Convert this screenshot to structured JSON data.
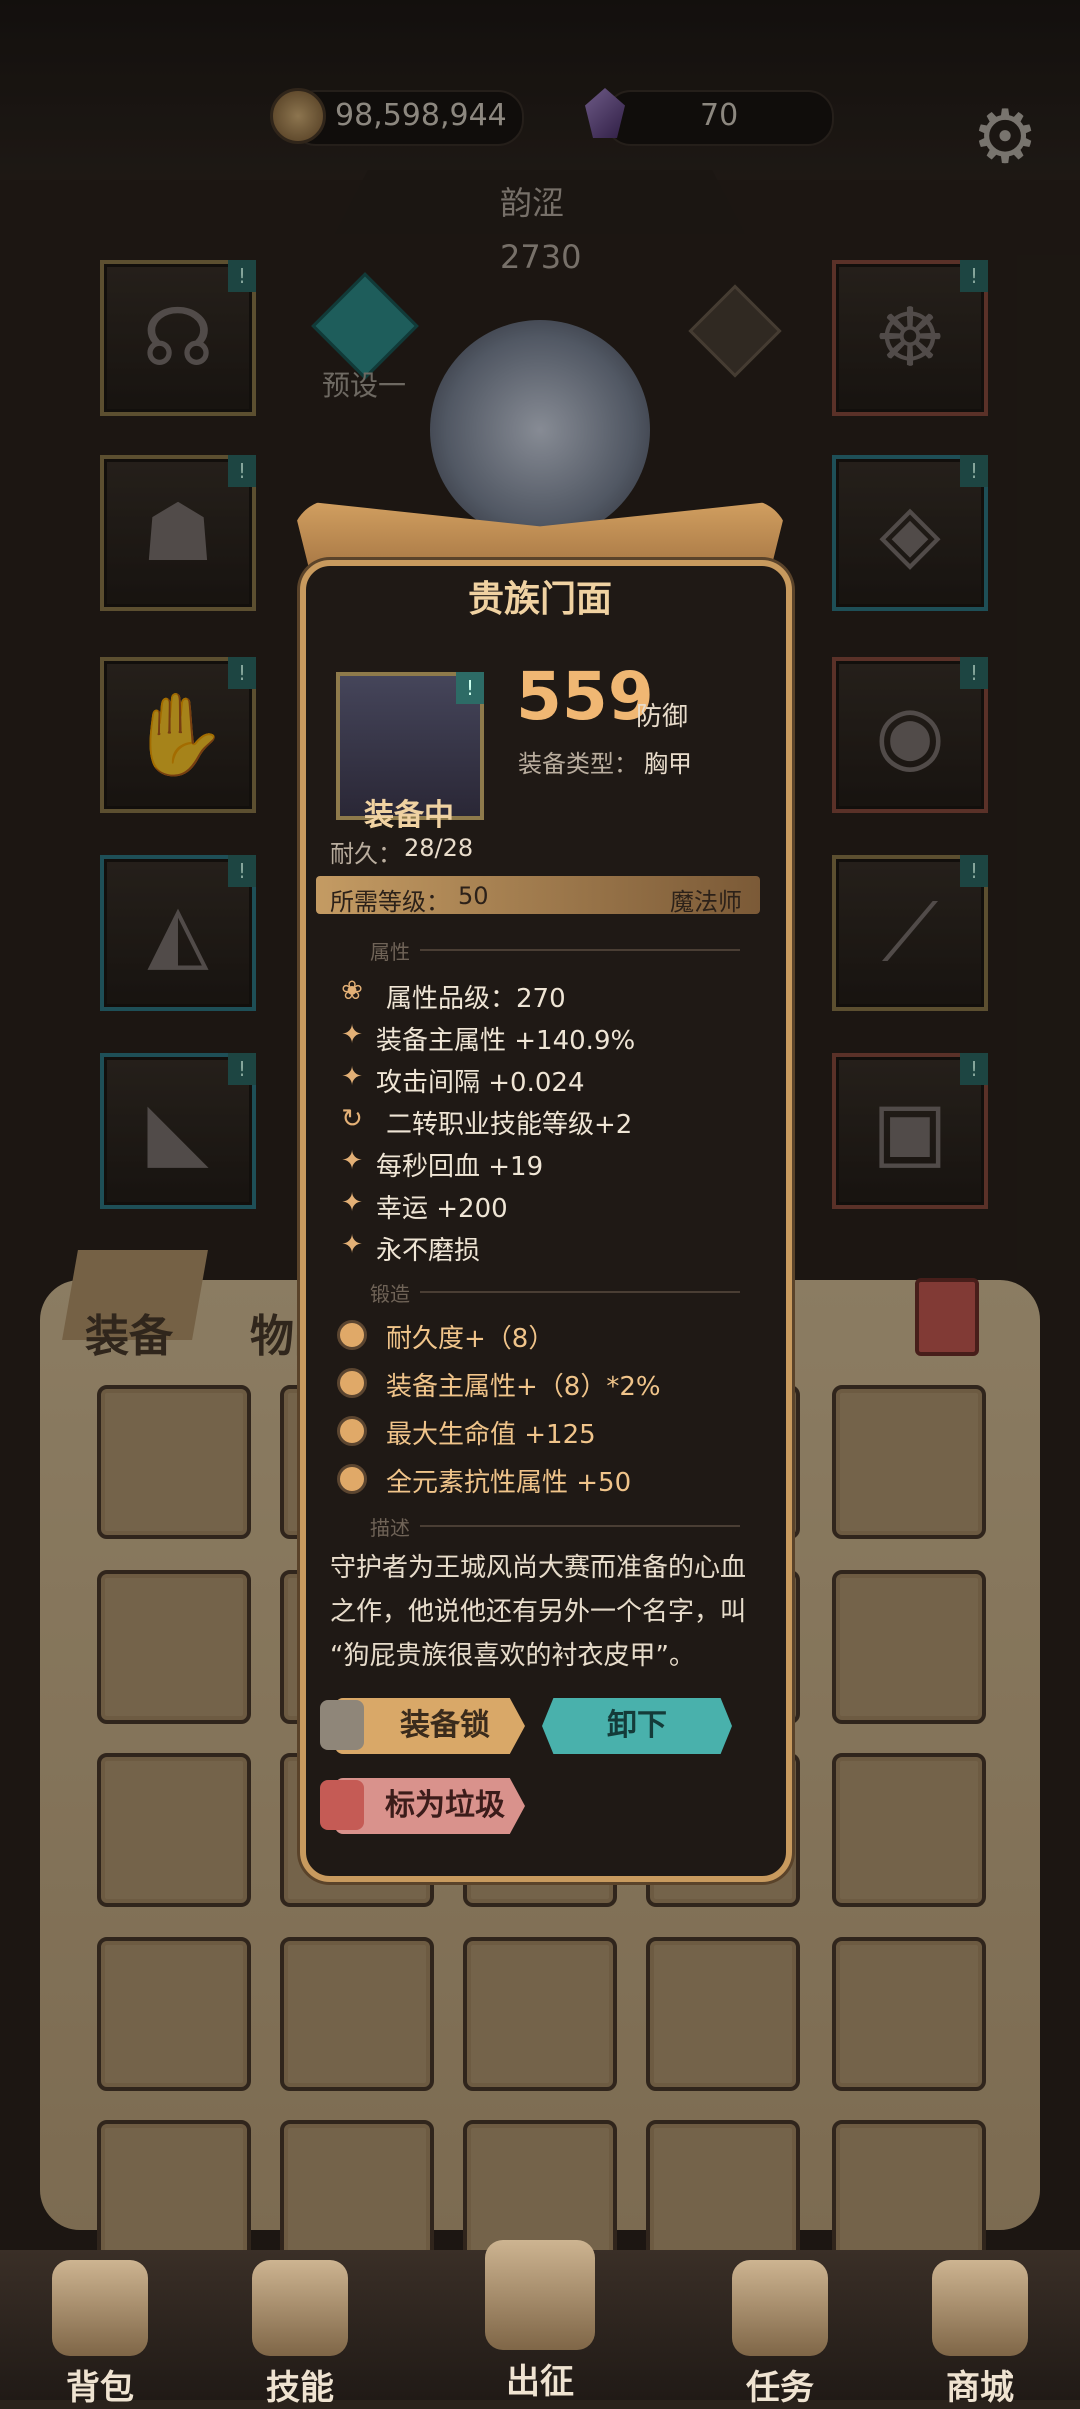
{
  "topbar": {
    "gold": "98,598,944",
    "gems": "70",
    "gold_icon": "gold-coin-icon",
    "gem_icon": "purple-gem-icon",
    "settings_icon": "gear-icon"
  },
  "character": {
    "name": "韵涩",
    "level": "2730",
    "preset_label": "预设一"
  },
  "bag": {
    "tabs": [
      "装备",
      "物品"
    ],
    "trash_icon": "trash-icon"
  },
  "popup": {
    "title": "贵族门面",
    "status": "装备中",
    "defense_value": "559",
    "defense_unit": "防御",
    "type_label": "装备类型：",
    "type_value": "胸甲",
    "durability_label": "耐久：",
    "durability_value": "28/28",
    "required_level_label": "所需等级：",
    "required_level_value": "50",
    "class": "魔法师",
    "sections": {
      "attributes": "属性",
      "forging": "锻造",
      "description": "描述"
    },
    "attributes": [
      {
        "icon": "lotus-icon",
        "text": "属性品级：270"
      },
      {
        "icon": "sparkle-icon",
        "text": "装备主属性 +140.9%"
      },
      {
        "icon": "sparkle-icon",
        "text": "攻击间隔 +0.024"
      },
      {
        "icon": "cycle-icon",
        "text": "二转职业技能等级+2"
      },
      {
        "icon": "sparkle-icon",
        "text": "每秒回血 +19"
      },
      {
        "icon": "sparkle-icon",
        "text": "幸运 +200"
      },
      {
        "icon": "sparkle-icon",
        "text": "永不磨损"
      }
    ],
    "forging": [
      "耐久度+（8）",
      "装备主属性+（8）*2%",
      "最大生命值 +125",
      "全元素抗性属性 +50"
    ],
    "description_lines": [
      "守护者为王城风尚大赛而准备的心血",
      "之作，他说他还有另外一个名字，叫",
      "“狗屁贵族很喜欢的衬衣皮甲”。"
    ],
    "buttons": {
      "lock": "装备锁",
      "unequip": "卸下",
      "junk": "标为垃圾"
    }
  },
  "bottom_nav": [
    {
      "label": "背包",
      "icon": "backpack-icon"
    },
    {
      "label": "技能",
      "icon": "skill-book-icon"
    },
    {
      "label": "出征",
      "icon": "sword-scroll-icon"
    },
    {
      "label": "任务",
      "icon": "scroll-quest-icon"
    },
    {
      "label": "商城",
      "icon": "crown-shop-icon"
    }
  ]
}
